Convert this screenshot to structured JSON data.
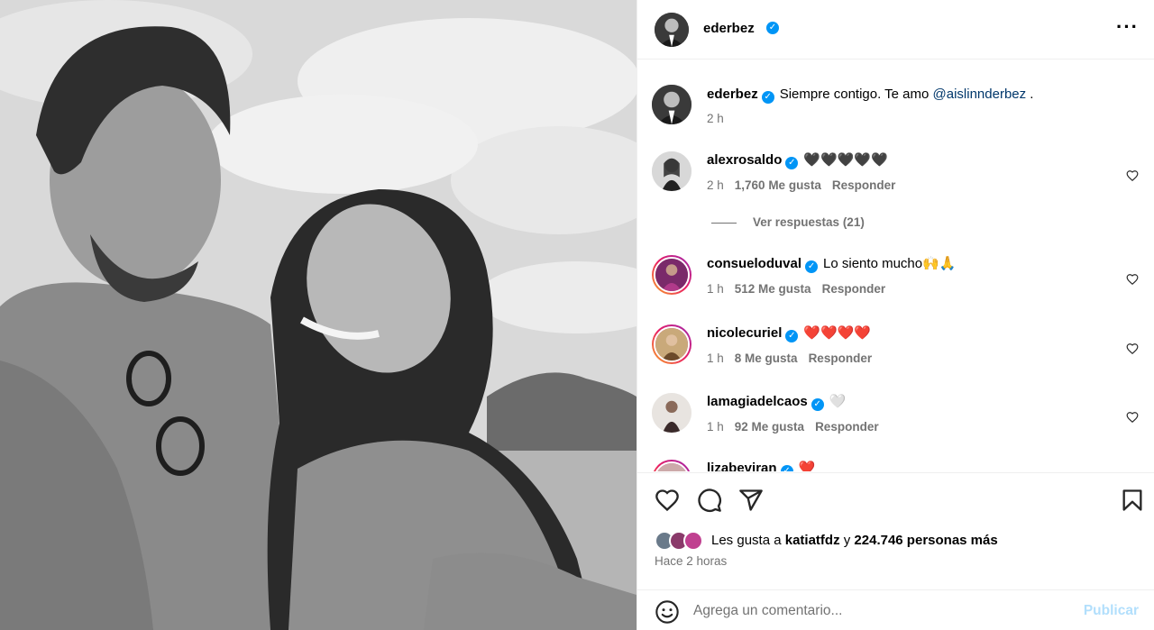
{
  "post": {
    "author": "ederbez",
    "more_icon": "more-options-icon",
    "caption": {
      "username": "ederbez",
      "text": "Siempre contigo. Te amo ",
      "mention": "@aislinnderbez",
      "suffix": " .",
      "time": "2 h"
    }
  },
  "comments": [
    {
      "username": "alexrosaldo",
      "text": "🖤🖤🖤🖤🖤",
      "time": "2 h",
      "likes": "1,760 Me gusta",
      "reply": "Responder"
    },
    {
      "username": "consueloduval",
      "text": "Lo siento mucho🙌🙏",
      "time": "1 h",
      "likes": "512 Me gusta",
      "reply": "Responder"
    },
    {
      "username": "nicolecuriel",
      "text": "❤️❤️❤️❤️",
      "time": "1 h",
      "likes": "8 Me gusta",
      "reply": "Responder"
    },
    {
      "username": "lamagiadelcaos",
      "text": "🤍",
      "time": "1 h",
      "likes": "92 Me gusta",
      "reply": "Responder"
    },
    {
      "username": "lizabeviran",
      "text": "❤️"
    }
  ],
  "view_replies": "Ver respuestas (21)",
  "likes_summary": {
    "prefix": "Les gusta a ",
    "user": "katiatfdz",
    "middle": " y ",
    "count": "224.746 personas más"
  },
  "posted_time": "Hace 2 horas",
  "comment_input": {
    "placeholder": "Agrega un comentario...",
    "publish_label": "Publicar"
  },
  "colors": {
    "verified": "#0095f6",
    "secondary_text": "#737373",
    "publish_disabled": "#b2dffc",
    "mention": "#00376b"
  }
}
